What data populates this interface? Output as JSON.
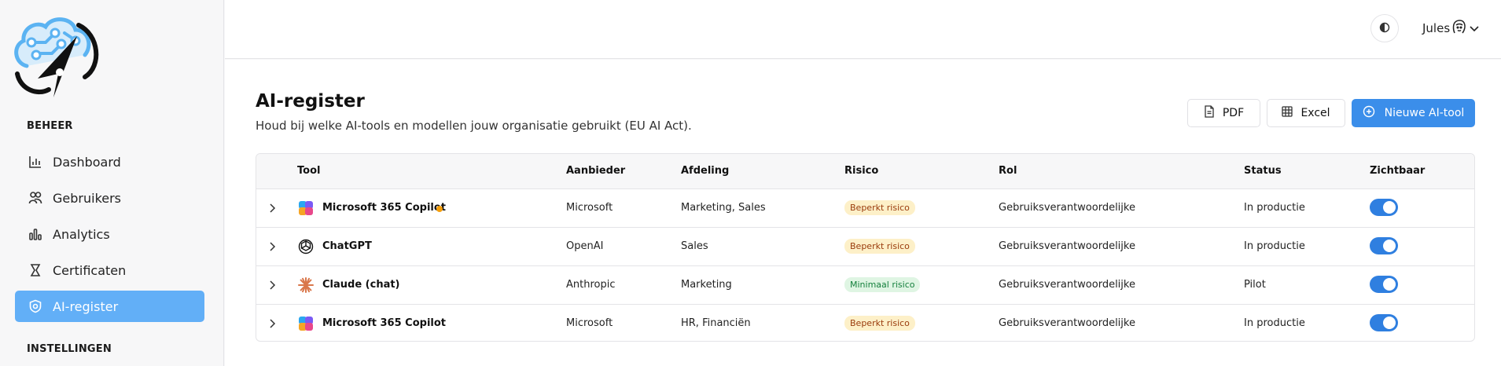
{
  "sidebar": {
    "sections": [
      {
        "label": "BEHEER"
      },
      {
        "label": "INSTELLINGEN"
      }
    ],
    "items": [
      {
        "label": "Dashboard",
        "icon": "bar-chart-icon"
      },
      {
        "label": "Gebruikers",
        "icon": "users-icon"
      },
      {
        "label": "Analytics",
        "icon": "analytics-icon"
      },
      {
        "label": "Certificaten",
        "icon": "certificate-icon"
      },
      {
        "label": "AI-register",
        "icon": "shield-icon",
        "active": true
      }
    ]
  },
  "header": {
    "user_name": "Jules"
  },
  "main": {
    "title": "AI-register",
    "subtitle": "Houd bij welke AI-tools en modellen jouw organisatie gebruikt (EU AI Act).",
    "buttons": {
      "pdf": "PDF",
      "excel": "Excel",
      "new_tool": "Nieuwe AI-tool"
    }
  },
  "table": {
    "columns": [
      "Tool",
      "Aanbieder",
      "Afdeling",
      "Risico",
      "Rol",
      "Status",
      "Zichtbaar"
    ],
    "rows": [
      {
        "tool": "Microsoft 365 Copilot",
        "icon": "copilot-icon",
        "dot": true,
        "provider": "Microsoft",
        "department": "Marketing, Sales",
        "risk": "Beperkt risico",
        "risk_level": "limited",
        "role": "Gebruiksverantwoordelijke",
        "status": "In productie",
        "visible": true
      },
      {
        "tool": "ChatGPT",
        "icon": "openai-icon",
        "dot": false,
        "provider": "OpenAI",
        "department": "Sales",
        "risk": "Beperkt risico",
        "risk_level": "limited",
        "role": "Gebruiksverantwoordelijke",
        "status": "In productie",
        "visible": true
      },
      {
        "tool": "Claude (chat)",
        "icon": "anthropic-icon",
        "dot": false,
        "provider": "Anthropic",
        "department": "Marketing",
        "risk": "Minimaal risico",
        "risk_level": "minimal",
        "role": "Gebruiksverantwoordelijke",
        "status": "Pilot",
        "visible": true
      },
      {
        "tool": "Microsoft 365 Copilot",
        "icon": "copilot-icon",
        "dot": false,
        "provider": "Microsoft",
        "department": "HR, Financiën",
        "risk": "Beperkt risico",
        "risk_level": "limited",
        "role": "Gebruiksverantwoordelijke",
        "status": "In productie",
        "visible": true
      }
    ]
  },
  "colors": {
    "accent": "#3b8eea",
    "active_nav": "#62aff7",
    "toggle_on": "#2f7fe0",
    "status_dot": "#f59e0b"
  }
}
